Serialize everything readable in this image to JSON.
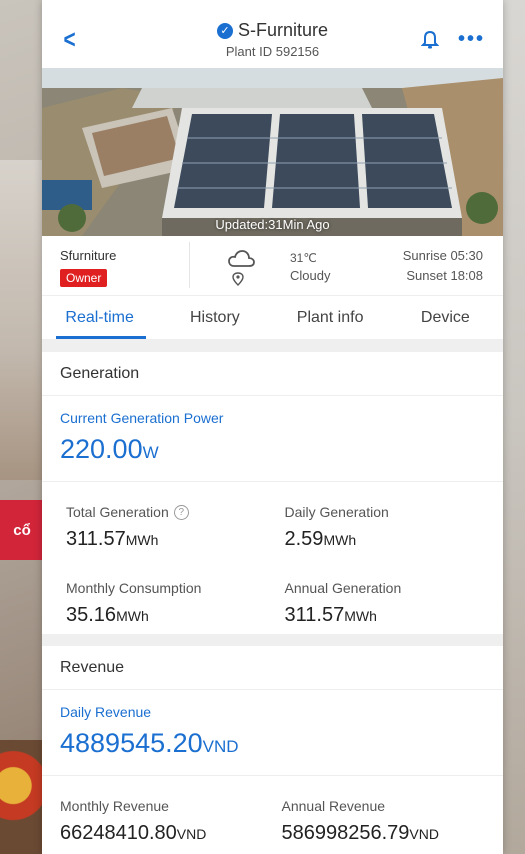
{
  "header": {
    "plant_name": "S-Furniture",
    "plant_id": "Plant ID 592156",
    "icons": {
      "back": "chevron-left-icon",
      "verified": "verified-check-icon",
      "bell": "bell-icon",
      "more": "more-icon"
    }
  },
  "photo": {
    "updated_text": "Updated:31Min Ago"
  },
  "info": {
    "owner_name": "Sfurniture",
    "owner_role": "Owner",
    "temperature": "31℃",
    "weather": "Cloudy",
    "sunrise": "Sunrise 05:30",
    "sunset": "Sunset 18:08"
  },
  "tabs": [
    {
      "label": "Real-time",
      "active": true
    },
    {
      "label": "History",
      "active": false
    },
    {
      "label": "Plant info",
      "active": false
    },
    {
      "label": "Device",
      "active": false
    }
  ],
  "generation": {
    "title": "Generation",
    "current_label": "Current Generation Power",
    "current_value": "220.00",
    "current_unit": "W",
    "items": [
      {
        "label": "Total Generation",
        "value": "311.57",
        "unit": "MWh"
      },
      {
        "label": "Daily Generation",
        "value": "2.59",
        "unit": "MWh"
      },
      {
        "label": "Monthly Consumption",
        "value": "35.16",
        "unit": "MWh"
      },
      {
        "label": "Annual Generation",
        "value": "311.57",
        "unit": "MWh"
      }
    ]
  },
  "revenue": {
    "title": "Revenue",
    "daily_label": "Daily Revenue",
    "daily_value": "4889545.20",
    "daily_unit": "VND",
    "items": [
      {
        "label": "Monthly Revenue",
        "value": "66248410.80",
        "unit": "VND"
      },
      {
        "label": "Annual Revenue",
        "value": "586998256.79",
        "unit": "VND"
      }
    ]
  },
  "background": {
    "sign_text": "cổ"
  },
  "colors": {
    "accent": "#1a6fd0",
    "owner_badge": "#e02020"
  }
}
